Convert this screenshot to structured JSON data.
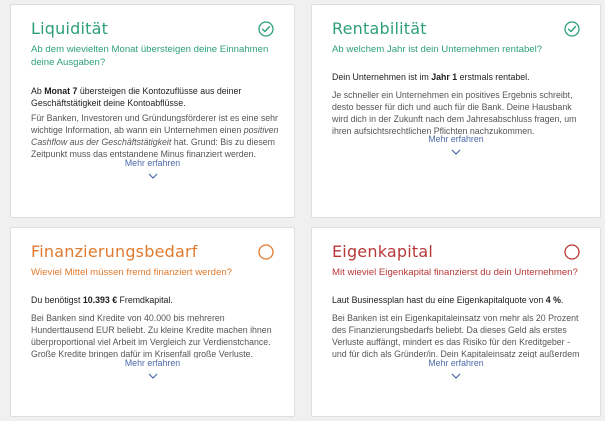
{
  "colors": {
    "green": "#2d9f7b",
    "orange": "#e07a2e",
    "red": "#b83838",
    "link": "#4a6aa8"
  },
  "more_label": "Mehr erfahren",
  "cards": [
    {
      "title": "Liquidität",
      "status": "done",
      "status_icon": "check-circle-icon",
      "question": "Ab dem wievielten Monat übersteigen deine Einnahmen deine Ausgaben?",
      "answer_pre": "Ab ",
      "answer_value": "Monat 7",
      "answer_post": " übersteigen die Kontozuflüsse aus deiner Geschäftstätigkeit deine Kontoabflüsse.",
      "detail_pre": "Für Banken, Investoren und Gründungsförderer ist es eine sehr wichtige Information, ab wann ein Unternehmen einen ",
      "detail_italic": "positiven Cashflow aus der Geschäftstätigkeit",
      "detail_post": " hat. Grund: Bis zu diesem Zeitpunkt muss das entstandene Minus finanziert werden."
    },
    {
      "title": "Rentabilität",
      "status": "done",
      "status_icon": "check-circle-icon",
      "question": "Ab welchem Jahr ist dein Unternehmen rentabel?",
      "answer_pre": "Dein Unternehmen ist im ",
      "answer_value": "Jahr 1",
      "answer_post": " erstmals rentabel.",
      "detail_pre": "Je schneller ein Unternehmen ein positives Ergebnis schreibt, desto besser für dich und auch für die Bank. Deine Hausbank wird dich in der Zukunft nach dem Jahresabschluss fragen, um ihren aufsichtsrechtlichen Pflichten nachzukommen.",
      "detail_italic": "",
      "detail_post": ""
    },
    {
      "title": "Finanzierungsbedarf",
      "status": "open",
      "status_icon": "empty-circle-icon",
      "question": "Wieviel Mittel müssen fremd finanziert werden?",
      "answer_pre": "Du benötigst ",
      "answer_value": "10.393 €",
      "answer_post": " Fremdkapital.",
      "detail_pre": "Bei Banken sind Kredite von 40.000 bis mehreren Hunderttausend EUR beliebt. Zu kleine Kredite machen ihnen überproportional viel Arbeit im Vergleich zur Verdienstchance. Große Kredite bringen dafür im Krisenfall große Verluste.",
      "detail_italic": "",
      "detail_post": ""
    },
    {
      "title": "Eigenkapital",
      "status": "open",
      "status_icon": "empty-circle-icon",
      "question": "Mit wieviel Eigenkapital finanzierst du dein Unternehmen?",
      "answer_pre": "Laut Businessplan hast du eine Eigenkapitalquote von ",
      "answer_value": "4 %",
      "answer_post": ".",
      "detail_pre": "Bei Banken ist ein Eigenkapitaleinsatz von mehr als 20 Prozent des Finanzierungsbedarfs beliebt. Da dieses Geld als erstes Verluste auffängt, mindert es das Risiko für den Kreditgeber - und für dich als Gründer/in. Dein Kapitaleinsatz zeigt außerdem dein Vertrauen in das Vorhaben.",
      "detail_italic": "",
      "detail_post": ""
    }
  ]
}
